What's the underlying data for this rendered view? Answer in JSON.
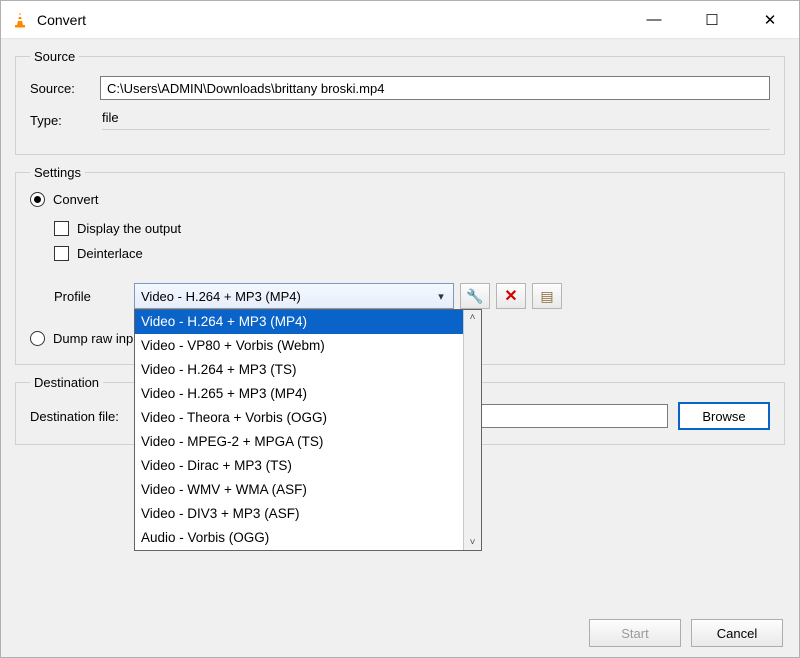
{
  "window": {
    "title": "Convert"
  },
  "source_group": {
    "legend": "Source",
    "source_label": "Source:",
    "source_value": "C:\\Users\\ADMIN\\Downloads\\brittany broski.mp4",
    "type_label": "Type:",
    "type_value": "file"
  },
  "settings_group": {
    "legend": "Settings",
    "convert_label": "Convert",
    "display_output_label": "Display the output",
    "deinterlace_label": "Deinterlace",
    "profile_label": "Profile",
    "profile_selected": "Video - H.264 + MP3 (MP4)",
    "profile_options": [
      "Video - H.264 + MP3 (MP4)",
      "Video - VP80 + Vorbis (Webm)",
      "Video - H.264 + MP3 (TS)",
      "Video - H.265 + MP3 (MP4)",
      "Video - Theora + Vorbis (OGG)",
      "Video - MPEG-2 + MPGA (TS)",
      "Video - Dirac + MP3 (TS)",
      "Video - WMV + WMA (ASF)",
      "Video - DIV3 + MP3 (ASF)",
      "Audio - Vorbis (OGG)"
    ],
    "dump_raw_label": "Dump raw input"
  },
  "destination_group": {
    "legend": "Destination",
    "dest_label": "Destination file:",
    "dest_value": "",
    "browse_label": "Browse"
  },
  "footer": {
    "start_label": "Start",
    "cancel_label": "Cancel"
  },
  "icons": {
    "minimize": "—",
    "maximize": "☐",
    "close": "✕",
    "wrench": "🔧",
    "delete": "✕",
    "listnew": "▤",
    "caret": "▾",
    "up": "˄",
    "down": "˅"
  }
}
